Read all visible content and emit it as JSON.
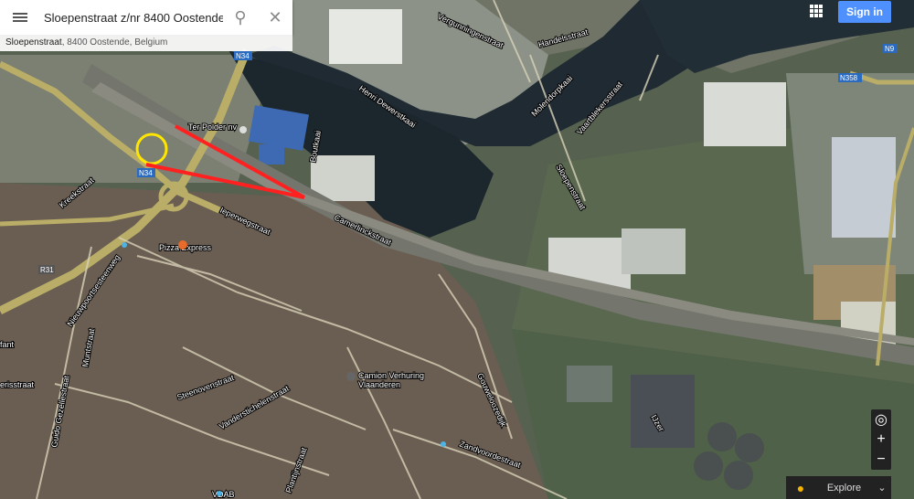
{
  "search": {
    "value": "Sloepenstraat z/nr 8400 Oostende"
  },
  "subtitle": {
    "street": "Sloepenstraat",
    "rest": ", 8400 Oostende, Belgium"
  },
  "header": {
    "sign_in": "Sign in"
  },
  "controls": {
    "zoom_in": "+",
    "zoom_out": "−",
    "explore": "Explore"
  },
  "labels": {
    "vergunningenstraat": "Vergunningenstraat",
    "handelsstraat": "Handelsstraat",
    "molendorpkaai": "Molendorpkaai",
    "vaartblekersstraat": "Vaartblekersstraat",
    "henri_dewerstkaai": "Henri Dewerstkaai",
    "sloepenstraat": "Sloepenstraat",
    "ter_polder": "Ter Polder nv",
    "boutkaai": "Boutkaai",
    "camerlinckstraat": "Camerlinckstraat",
    "ieperweg": "Ieperwegstraat",
    "kreekstraat": "Kreekstraat",
    "pizza": "Pizza Express",
    "nieuwstraat": "Nieuwpoortsesteenweg",
    "muntstraat": "Muntstraat",
    "steenovenstraat": "Steenovenstraat",
    "vanderstichelen": "Vanderstichelenstraat",
    "camion": "Camion Verhuring",
    "vlaanderen": "Vlaanderen",
    "gouweloos": "Gouweloozedijk",
    "zandvoorde": "Zandvoordestraat",
    "plantijn": "Plantijnstraat",
    "vdab": "VDAB",
    "guido": "Guido Gezellestraat",
    "erisstraat": "erisstraat",
    "fant": "fant",
    "n34": "N34",
    "n34b": "N34",
    "n358": "N358",
    "n9": "N9",
    "r31": "R31",
    "ijzer": "IJzer"
  },
  "colors": {
    "marker": "#ff2020",
    "circle": "#ffe600",
    "signin": "#4d90fe"
  }
}
